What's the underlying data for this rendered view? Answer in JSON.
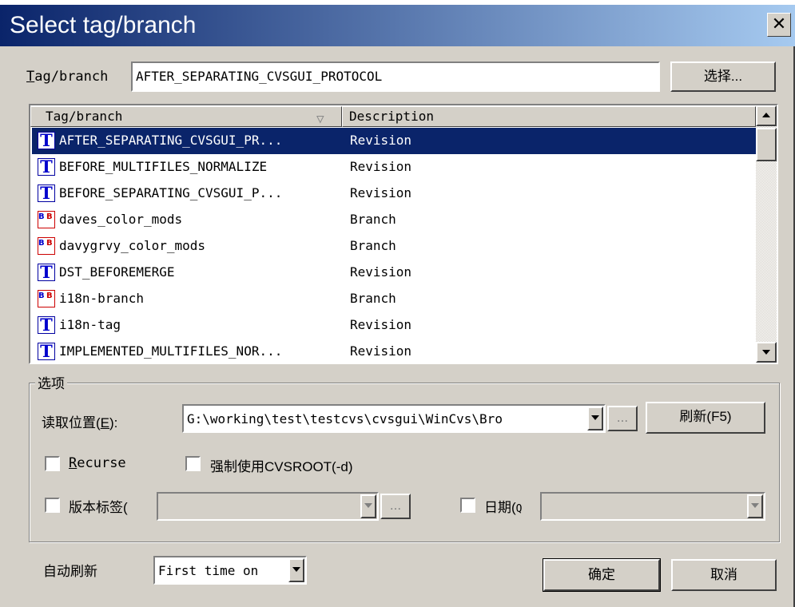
{
  "dialog": {
    "title": "Select tag/branch",
    "close_glyph": "✕"
  },
  "tag_field": {
    "label_mnemonic": "T",
    "label_rest": "ag/branch",
    "value": "AFTER_SEPARATING_CVSGUI_PROTOCOL",
    "select_button": "选择..."
  },
  "list": {
    "columns": [
      "Tag/branch",
      "Description"
    ],
    "sort_indicator": "▽",
    "rows": [
      {
        "name": "AFTER_SEPARATING_CVSGUI_PR...",
        "desc": "Revision",
        "icon": "revision-tag-icon",
        "selected": true
      },
      {
        "name": "BEFORE_MULTIFILES_NORMALIZE",
        "desc": "Revision",
        "icon": "revision-tag-icon"
      },
      {
        "name": "BEFORE_SEPARATING_CVSGUI_P...",
        "desc": "Revision",
        "icon": "revision-tag-icon"
      },
      {
        "name": "daves_color_mods",
        "desc": "Branch",
        "icon": "branch-icon"
      },
      {
        "name": "davygrvy_color_mods",
        "desc": "Branch",
        "icon": "branch-icon"
      },
      {
        "name": "DST_BEFOREMERGE",
        "desc": "Revision",
        "icon": "revision-tag-icon"
      },
      {
        "name": "i18n-branch",
        "desc": "Branch",
        "icon": "branch-icon"
      },
      {
        "name": "i18n-tag",
        "desc": "Revision",
        "icon": "revision-tag-icon"
      },
      {
        "name": "IMPLEMENTED_MULTIFILES_NOR...",
        "desc": "Revision",
        "icon": "revision-tag-icon"
      }
    ]
  },
  "options": {
    "group_label": "选项",
    "read_location_label": "读取位置(",
    "read_location_mnemonic": "E",
    "read_location_suffix": "):",
    "read_location_value": "G:\\working\\test\\testcvs\\cvsgui\\WinCvs\\Bro",
    "browse_button": "...",
    "refresh_button": "刷新(F5)",
    "recurse_mnemonic": "R",
    "recurse_rest": "ecurse",
    "force_cvsroot": "强制使用CVSROOT(-d)",
    "version_tag": "版本标签(",
    "date_label": "日期(",
    "date_suffix": "Q"
  },
  "footer": {
    "auto_refresh_label": "自动刷新",
    "auto_refresh_value": "First time on",
    "ok": "确定",
    "cancel": "取消"
  },
  "colors": {
    "title_start": "#0a246a",
    "title_end": "#a6caf0",
    "selection": "#0a246a"
  }
}
